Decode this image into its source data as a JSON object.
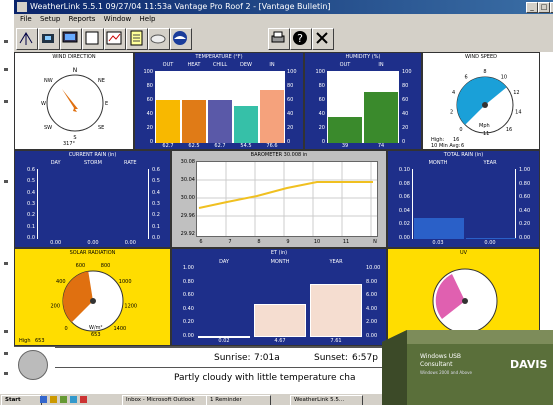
{
  "window": {
    "title": "WeatherLink 5.5.1  09/27/04  11:53a  Vantage Pro Roof 2 - [Vantage Bulletin]"
  },
  "menu": [
    "File",
    "Setup",
    "Reports",
    "Window",
    "Help"
  ],
  "wind_direction": {
    "title": "WIND DIRECTION",
    "n": "N",
    "ne": "NE",
    "e": "E",
    "se": "SE",
    "s": "S",
    "sw": "SW",
    "w": "W",
    "nw": "NW",
    "value": "317°"
  },
  "temperature": {
    "title": "TEMPERATURE (°F)",
    "labels": [
      "OUT",
      "HEAT",
      "CHILL",
      "DEW",
      "IN"
    ],
    "values": [
      "62.7",
      "62.5",
      "62.7",
      "54.5",
      "76.6"
    ],
    "levels": [
      0.63,
      0.63,
      0.63,
      0.54,
      0.77
    ],
    "colors": [
      "#f8b800",
      "#e07b17",
      "#5a59a8",
      "#36c0a8",
      "#f5a27c"
    ],
    "axis": [
      "100",
      "80",
      "60",
      "40",
      "20",
      "0"
    ]
  },
  "humidity": {
    "title": "HUMIDITY (%)",
    "labels": [
      "OUT",
      "IN"
    ],
    "values": [
      "39",
      "74"
    ],
    "levels": [
      0.39,
      0.74
    ],
    "axis": [
      "100",
      "80",
      "60",
      "40",
      "20",
      "0"
    ]
  },
  "wind_speed": {
    "title": "WIND SPEED",
    "ticks": [
      "0",
      "2",
      "4",
      "6",
      "8",
      "10",
      "12",
      "14",
      "16"
    ],
    "unit": "Mph",
    "value": "11",
    "high_label": "High:",
    "high_value": "16",
    "avg_label": "10 Min Avg:",
    "avg_value": "6"
  },
  "current_rain": {
    "title": "CURRENT RAIN (in)",
    "labels": [
      "DAY",
      "STORM",
      "RATE"
    ],
    "axis": [
      "0.6",
      "0.5",
      "0.4",
      "0.3",
      "0.2",
      "0.1",
      "0.0"
    ],
    "values": [
      "0.00",
      "0.00",
      "0.00"
    ]
  },
  "barometer": {
    "title": "BAROMETER 30.008 in",
    "y_ticks": [
      "30.08",
      "30.04",
      "30.00",
      "29.96",
      "29.92"
    ],
    "x_ticks": [
      "6",
      "7",
      "8",
      "9",
      "10",
      "11",
      "N"
    ]
  },
  "total_rain": {
    "title": "TOTAL RAIN (in)",
    "labels": [
      "MONTH",
      "YEAR"
    ],
    "axis_left": [
      "0.10",
      "0.08",
      "0.06",
      "0.04",
      "0.02",
      "0.00"
    ],
    "axis_right": [
      "1.00",
      "0.80",
      "0.60",
      "0.40",
      "0.20",
      "0.00"
    ],
    "values": [
      "0.03",
      "0.00"
    ],
    "levels": [
      0.3,
      0.02
    ]
  },
  "solar": {
    "title": "SOLAR RADIATION",
    "ticks": [
      "0",
      "200",
      "400",
      "600",
      "800",
      "1000",
      "1200",
      "1400"
    ],
    "unit": "W/m²",
    "value": "653",
    "high_label": "High",
    "high_value": "653"
  },
  "et": {
    "title": "ET (in)",
    "labels": [
      "DAY",
      "MONTH",
      "YEAR"
    ],
    "axis_left": [
      "1.00",
      "0.80",
      "0.60",
      "0.40",
      "0.20",
      "0.00"
    ],
    "axis_right": [
      "10.00",
      "8.00",
      "6.00",
      "4.00",
      "2.00",
      "0.00"
    ],
    "values": [
      "0.02",
      "4.67",
      "7.61"
    ],
    "levels": [
      0.02,
      0.47,
      0.76
    ]
  },
  "uv": {
    "title": "UV",
    "unit": "index"
  },
  "sun": {
    "sunrise_label": "Sunrise:",
    "sunrise": "7:01a",
    "sunset_label": "Sunset:",
    "sunset": "6:57p",
    "forecast": "Partly cloudy with little temperature cha"
  },
  "taskbar": {
    "start": "Start",
    "tasks": [
      "Inbox - Microsoft Outlook",
      "1 Reminder",
      "WeatherLink 5.5..."
    ]
  },
  "product_box": {
    "line1": "Windows USB",
    "line2": "Consultant",
    "line3": "Windows 2000 and Above",
    "brand": "DAVIS"
  }
}
